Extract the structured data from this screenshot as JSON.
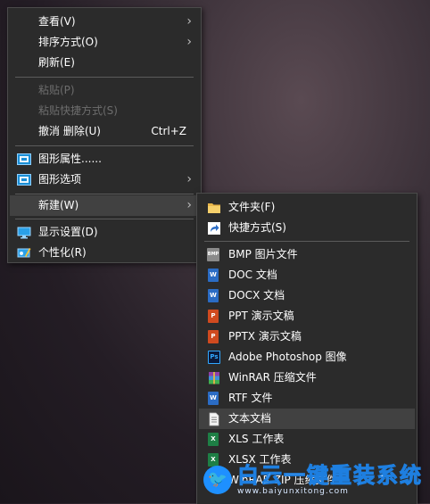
{
  "main_menu": {
    "items": [
      {
        "label": "查看(V)",
        "submenu": true
      },
      {
        "label": "排序方式(O)",
        "submenu": true
      },
      {
        "label": "刷新(E)"
      },
      {
        "label": "粘贴(P)",
        "disabled": true
      },
      {
        "label": "粘贴快捷方式(S)",
        "disabled": true
      },
      {
        "label": "撤消 删除(U)",
        "shortcut": "Ctrl+Z"
      },
      {
        "label": "图形属性......",
        "icon": "graphics-properties-icon"
      },
      {
        "label": "图形选项",
        "icon": "graphics-options-icon",
        "submenu": true
      },
      {
        "label": "新建(W)",
        "submenu": true,
        "highlighted": true
      },
      {
        "label": "显示设置(D)",
        "icon": "display-settings-icon"
      },
      {
        "label": "个性化(R)",
        "icon": "personalize-icon"
      }
    ]
  },
  "sub_menu": {
    "items": [
      {
        "label": "文件夹(F)",
        "icon": "folder-icon"
      },
      {
        "label": "快捷方式(S)",
        "icon": "shortcut-icon"
      },
      {
        "label": "BMP 图片文件",
        "icon": "bmp-file-icon",
        "badge": "BMP"
      },
      {
        "label": "DOC 文档",
        "icon": "word-doc-icon",
        "badge": "W"
      },
      {
        "label": "DOCX 文档",
        "icon": "word-docx-icon",
        "badge": "W"
      },
      {
        "label": "PPT 演示文稿",
        "icon": "ppt-file-icon",
        "badge": "P"
      },
      {
        "label": "PPTX 演示文稿",
        "icon": "pptx-file-icon",
        "badge": "P"
      },
      {
        "label": "Adobe Photoshop 图像",
        "icon": "photoshop-file-icon",
        "badge": "Ps"
      },
      {
        "label": "WinRAR 压缩文件",
        "icon": "winrar-file-icon"
      },
      {
        "label": "RTF 文件",
        "icon": "rtf-file-icon",
        "badge": "W"
      },
      {
        "label": "文本文档",
        "icon": "text-file-icon",
        "highlighted": true
      },
      {
        "label": "XLS 工作表",
        "icon": "xls-file-icon",
        "badge": "X"
      },
      {
        "label": "XLSX 工作表",
        "icon": "xlsx-file-icon",
        "badge": "X"
      },
      {
        "label": "WinRAR ZIP 压缩文件",
        "icon": "winrar-zip-file-icon"
      }
    ]
  },
  "submenu_arrow": "›",
  "watermark": {
    "title": "白云一键重装系统",
    "url": "www.baiyunxitong.com",
    "logo_glyph": "🐦"
  },
  "colors": {
    "menu_bg": "#2b2b2b",
    "highlight": "#414141",
    "disabled_text": "#6d6d6d",
    "word_blue": "#2b6cc4",
    "ppt_orange": "#d04a1f",
    "excel_green": "#1e7f45",
    "ps_blue": "#0b1a3a",
    "watermark_blue": "#1e90ff"
  }
}
